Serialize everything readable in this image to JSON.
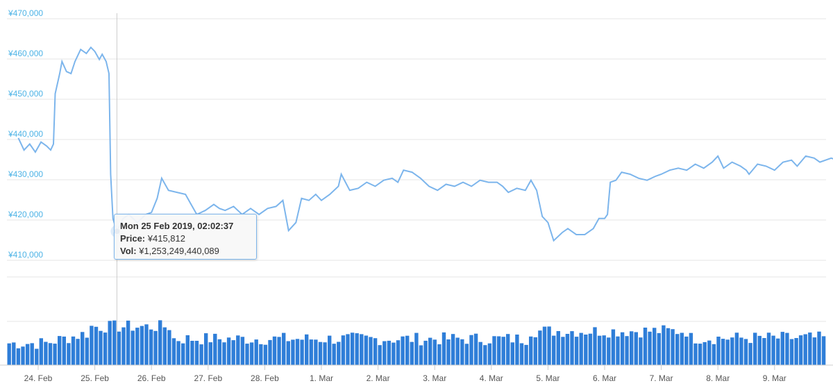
{
  "chart_data": {
    "type": "line",
    "currency": "¥",
    "y_ticks": [
      "¥410,000",
      "¥420,000",
      "¥430,000",
      "¥440,000",
      "¥450,000",
      "¥460,000",
      "¥470,000"
    ],
    "ylim": [
      407000,
      470000
    ],
    "x_ticks": [
      "24. Feb",
      "25. Feb",
      "26. Feb",
      "27. Feb",
      "28. Feb",
      "1. Mar",
      "2. Mar",
      "3. Mar",
      "4. Mar",
      "5. Mar",
      "6. Mar",
      "7. Mar",
      "8. Mar",
      "9. Mar"
    ],
    "xlim": [
      -0.35,
      14.6
    ],
    "price_series": {
      "color": "#7cb5ec",
      "points": [
        [
          -0.35,
          439000
        ],
        [
          -0.25,
          436000
        ],
        [
          -0.15,
          437500
        ],
        [
          -0.05,
          435500
        ],
        [
          0.05,
          438000
        ],
        [
          0.15,
          437000
        ],
        [
          0.22,
          436000
        ],
        [
          0.27,
          437500
        ],
        [
          0.3,
          450000
        ],
        [
          0.38,
          455000
        ],
        [
          0.42,
          458000
        ],
        [
          0.5,
          455500
        ],
        [
          0.58,
          455000
        ],
        [
          0.65,
          458000
        ],
        [
          0.75,
          461000
        ],
        [
          0.85,
          460000
        ],
        [
          0.93,
          461500
        ],
        [
          1.0,
          460500
        ],
        [
          1.08,
          458500
        ],
        [
          1.13,
          459800
        ],
        [
          1.2,
          458000
        ],
        [
          1.25,
          455000
        ],
        [
          1.28,
          430000
        ],
        [
          1.32,
          419000
        ],
        [
          1.39,
          415812
        ],
        [
          1.5,
          419000
        ],
        [
          1.6,
          420000
        ],
        [
          1.75,
          418000
        ],
        [
          1.9,
          420000
        ],
        [
          2.0,
          420500
        ],
        [
          2.1,
          424000
        ],
        [
          2.18,
          429000
        ],
        [
          2.3,
          426000
        ],
        [
          2.45,
          425500
        ],
        [
          2.6,
          425000
        ],
        [
          2.7,
          422500
        ],
        [
          2.8,
          420000
        ],
        [
          2.95,
          421000
        ],
        [
          3.1,
          422500
        ],
        [
          3.2,
          421500
        ],
        [
          3.3,
          421000
        ],
        [
          3.45,
          422000
        ],
        [
          3.6,
          420000
        ],
        [
          3.75,
          421500
        ],
        [
          3.9,
          420000
        ],
        [
          4.05,
          421500
        ],
        [
          4.2,
          422000
        ],
        [
          4.32,
          423500
        ],
        [
          4.42,
          416000
        ],
        [
          4.55,
          418000
        ],
        [
          4.65,
          424000
        ],
        [
          4.78,
          423500
        ],
        [
          4.9,
          425000
        ],
        [
          5.0,
          423500
        ],
        [
          5.15,
          425000
        ],
        [
          5.3,
          427000
        ],
        [
          5.35,
          430000
        ],
        [
          5.5,
          426000
        ],
        [
          5.65,
          426500
        ],
        [
          5.8,
          428000
        ],
        [
          5.95,
          427000
        ],
        [
          6.1,
          428500
        ],
        [
          6.25,
          429000
        ],
        [
          6.35,
          428000
        ],
        [
          6.45,
          431000
        ],
        [
          6.6,
          430500
        ],
        [
          6.75,
          429000
        ],
        [
          6.9,
          427000
        ],
        [
          7.05,
          426000
        ],
        [
          7.2,
          427500
        ],
        [
          7.35,
          427000
        ],
        [
          7.5,
          428000
        ],
        [
          7.65,
          427000
        ],
        [
          7.8,
          428500
        ],
        [
          7.95,
          428000
        ],
        [
          8.1,
          428000
        ],
        [
          8.2,
          427000
        ],
        [
          8.3,
          425500
        ],
        [
          8.45,
          426500
        ],
        [
          8.6,
          426000
        ],
        [
          8.7,
          428500
        ],
        [
          8.8,
          426000
        ],
        [
          8.9,
          419500
        ],
        [
          9.0,
          418000
        ],
        [
          9.1,
          413500
        ],
        [
          9.25,
          415500
        ],
        [
          9.35,
          416500
        ],
        [
          9.5,
          415000
        ],
        [
          9.65,
          415000
        ],
        [
          9.8,
          416500
        ],
        [
          9.9,
          419000
        ],
        [
          10.0,
          419000
        ],
        [
          10.05,
          420000
        ],
        [
          10.1,
          428000
        ],
        [
          10.2,
          428500
        ],
        [
          10.3,
          430500
        ],
        [
          10.45,
          430000
        ],
        [
          10.6,
          429000
        ],
        [
          10.75,
          428500
        ],
        [
          10.9,
          429500
        ],
        [
          11.0,
          430000
        ],
        [
          11.15,
          431000
        ],
        [
          11.3,
          431500
        ],
        [
          11.45,
          431000
        ],
        [
          11.6,
          432500
        ],
        [
          11.75,
          431500
        ],
        [
          11.9,
          433000
        ],
        [
          12.0,
          434500
        ],
        [
          12.1,
          431500
        ],
        [
          12.25,
          433000
        ],
        [
          12.4,
          432000
        ],
        [
          12.5,
          431000
        ],
        [
          12.55,
          430000
        ],
        [
          12.7,
          432500
        ],
        [
          12.85,
          432000
        ],
        [
          13.0,
          431000
        ],
        [
          13.15,
          433000
        ],
        [
          13.3,
          433500
        ],
        [
          13.4,
          432000
        ],
        [
          13.55,
          434500
        ],
        [
          13.7,
          434000
        ],
        [
          13.8,
          433000
        ],
        [
          14.0,
          434000
        ],
        [
          14.1,
          433500
        ],
        [
          14.3,
          434800
        ],
        [
          14.4,
          434500
        ],
        [
          14.45,
          432000
        ],
        [
          14.52,
          427000
        ],
        [
          14.57,
          431000
        ],
        [
          14.62,
          432000
        ]
      ]
    },
    "volume_series": {
      "color": "#2f7ed8",
      "grid_label": "",
      "bars_per_day": 12,
      "approx_height_fractions": [
        0.55,
        0.6,
        0.58,
        0.62,
        0.5,
        0.64,
        0.66,
        0.6,
        0.58,
        0.52,
        0.48,
        0.56,
        0.7,
        0.75,
        0.8,
        0.78,
        0.82,
        0.85,
        0.8,
        0.86,
        0.84,
        0.78,
        0.76,
        0.74,
        0.94,
        0.9,
        0.92,
        0.88,
        0.87,
        0.9,
        0.86,
        0.84,
        0.83,
        0.85,
        0.88,
        0.82
      ]
    },
    "tooltip": {
      "title": "Mon 25 Feb 2019, 02:02:37",
      "price_label": "Price:",
      "price_value": "¥415,812",
      "vol_label": "Vol:",
      "vol_value": "¥1,253,249,440,089"
    },
    "grid": true
  }
}
